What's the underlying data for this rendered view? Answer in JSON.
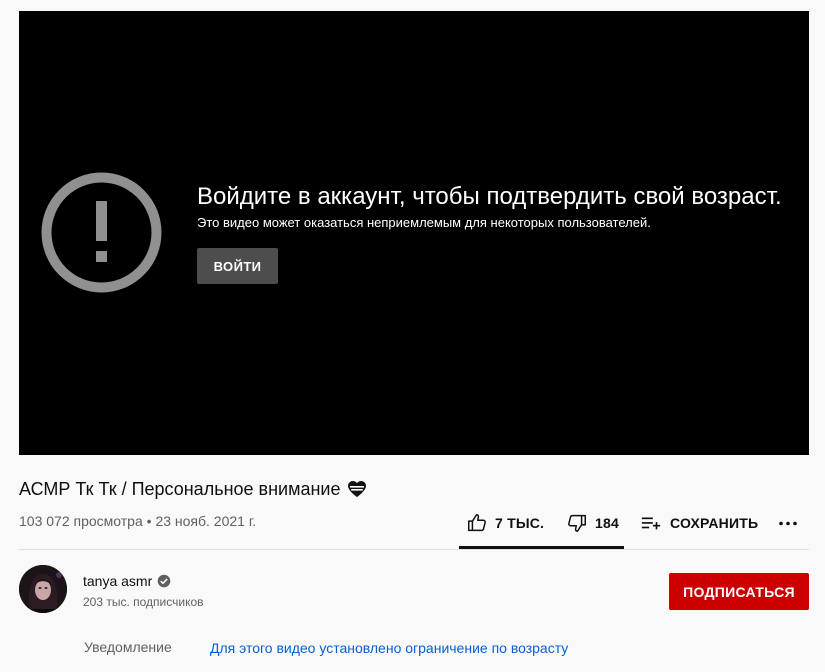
{
  "player": {
    "message_title": "Войдите в аккаунт, чтобы подтвердить свой возраст.",
    "message_subtitle": "Это видео может оказаться неприемлемым для некоторых пользователей.",
    "login_label": "ВОЙТИ",
    "icon": "exclamation-circle-icon"
  },
  "video": {
    "title": "АСМР Тк Тк / Персональное внимание",
    "title_emoji": "❤️",
    "views": "103 072 просмотра",
    "separator": "•",
    "date": "23 нояб. 2021 г."
  },
  "actions": {
    "like_count": "7 ТЫС.",
    "dislike_count": "184",
    "save_label": "СОХРАНИТЬ",
    "icons": [
      "thumb-up-icon",
      "thumb-down-icon",
      "playlist-add-icon",
      "more-icon"
    ]
  },
  "channel": {
    "name": "tanya asmr",
    "subscribers": "203 тыс. подписчиков",
    "subscribe_label": "ПОДПИСАТЬСЯ",
    "verified_icon": "verified-check-icon"
  },
  "notice": {
    "label": "Уведомление",
    "text": "Для этого видео установлено ограничение по возрасту"
  },
  "colors": {
    "player_bg": "#000000",
    "page_bg": "#f9f9f9",
    "subscribe_red": "#cc0000",
    "link_blue": "#065fd4",
    "icon_gray": "#909090"
  }
}
